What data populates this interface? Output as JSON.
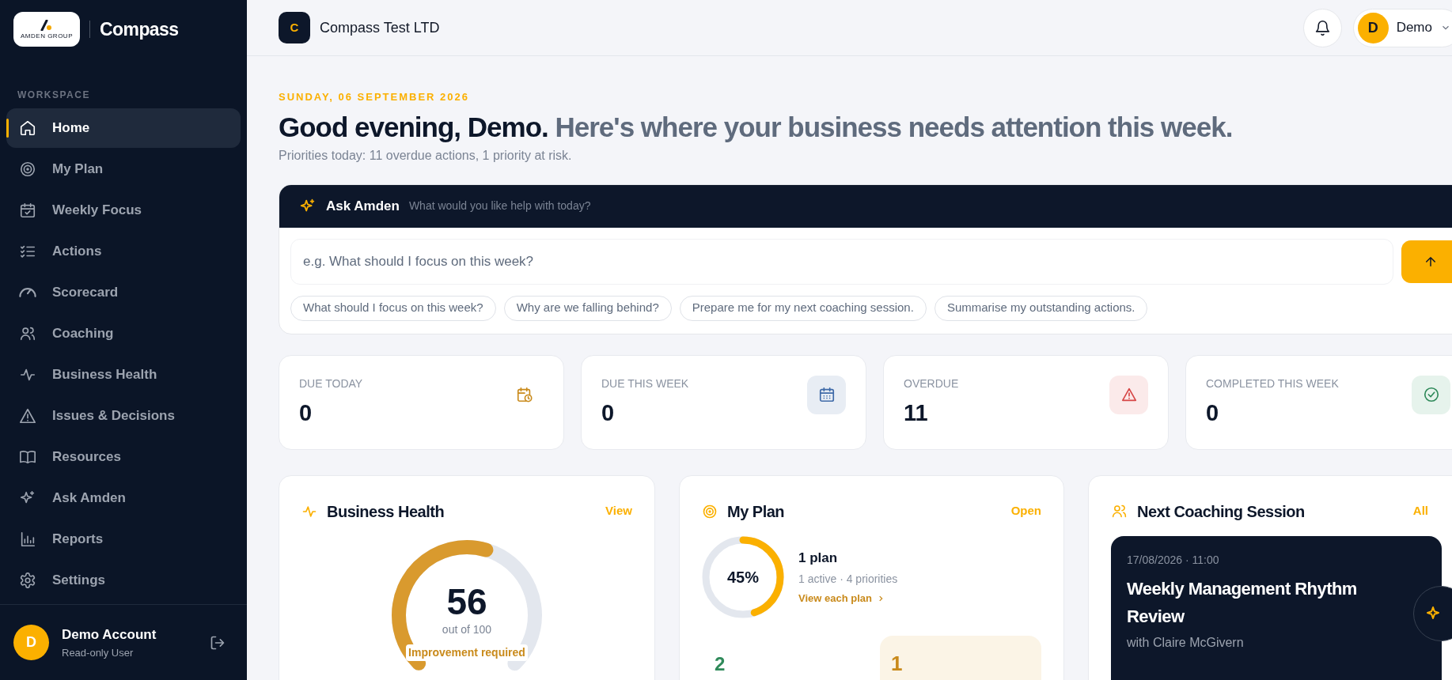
{
  "sidebar": {
    "brand": {
      "logo_text": "AMDEN GROUP",
      "app_name": "Compass"
    },
    "section_label": "WORKSPACE",
    "items": [
      {
        "label": "Home",
        "selected": true
      },
      {
        "label": "My Plan",
        "selected": false
      },
      {
        "label": "Weekly Focus",
        "selected": false
      },
      {
        "label": "Actions",
        "selected": false
      },
      {
        "label": "Scorecard",
        "selected": false
      },
      {
        "label": "Coaching",
        "selected": false
      },
      {
        "label": "Business Health",
        "selected": false
      },
      {
        "label": "Issues & Decisions",
        "selected": false
      },
      {
        "label": "Resources",
        "selected": false
      },
      {
        "label": "Ask Amden",
        "selected": false
      },
      {
        "label": "Reports",
        "selected": false
      },
      {
        "label": "Settings",
        "selected": false
      }
    ],
    "user": {
      "initial": "D",
      "name": "Demo Account",
      "role": "Read-only User"
    }
  },
  "header": {
    "company": {
      "initial": "C",
      "name": "Compass Test LTD"
    },
    "user": {
      "initial": "D",
      "name": "Demo"
    }
  },
  "greeting": {
    "date": "SUNDAY, 06 SEPTEMBER 2026",
    "headline_lead": "Good evening, Demo.",
    "headline_rest": "Here's where your business needs attention this week.",
    "summary": "Priorities today: 11 overdue actions, 1 priority at risk."
  },
  "ask": {
    "title": "Ask Amden",
    "subtitle": "What would you like help with today?",
    "placeholder": "e.g. What should I focus on this week?",
    "suggestions": [
      "What should I focus on this week?",
      "Why are we falling behind?",
      "Prepare me for my next coaching session.",
      "Summarise my outstanding actions."
    ]
  },
  "stats": [
    {
      "kind": "today",
      "label": "DUE TODAY",
      "value": "0"
    },
    {
      "kind": "week",
      "label": "DUE THIS WEEK",
      "value": "0"
    },
    {
      "kind": "overdue",
      "label": "OVERDUE",
      "value": "11"
    },
    {
      "kind": "completed",
      "label": "COMPLETED THIS WEEK",
      "value": "0"
    }
  ],
  "business_health": {
    "title": "Business Health",
    "link": "View",
    "score": "56",
    "caption": "out of 100",
    "status": "Improvement required",
    "level": 0.56
  },
  "my_plan": {
    "title": "My Plan",
    "link": "Open",
    "percent": "45%",
    "level": 0.45,
    "plan_count": "1 plan",
    "details": "1 active · 4 priorities",
    "plans_link": "View each plan",
    "metric_1": "2",
    "metric_2": "1"
  },
  "coaching": {
    "title": "Next Coaching Session",
    "link": "All",
    "session": {
      "when": "17/08/2026 · 11:00",
      "title": "Weekly Management Rhythm Review",
      "coach": "with Claire McGivern"
    }
  }
}
